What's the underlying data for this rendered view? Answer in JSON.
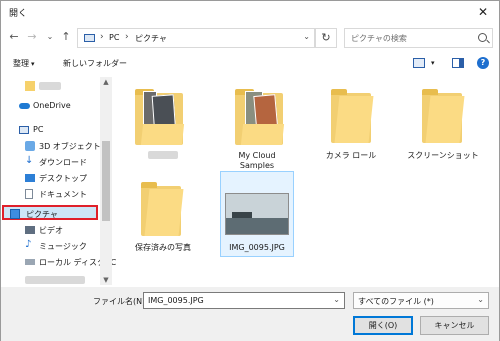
{
  "window": {
    "title": "開く",
    "close_glyph": "✕"
  },
  "nav": {
    "back_glyph": "←",
    "forward_glyph": "→",
    "recent_glyph": "⌄",
    "up_glyph": "↑",
    "breadcrumb": [
      "PC",
      "ピクチャ"
    ],
    "breadcrumb_sep": "›",
    "refresh_glyph": "↻",
    "search_placeholder": "ピクチャの検索"
  },
  "commands": {
    "organize": "整理",
    "new_folder": "新しいフォルダー",
    "caret": "▾",
    "help": "?"
  },
  "navpane": {
    "items": [
      {
        "label": "OneDrive",
        "icon": "onedrive-icon"
      },
      {
        "label": "PC",
        "icon": "pc-icon"
      },
      {
        "label": "3D オブジェクト",
        "icon": "3d-objects-icon"
      },
      {
        "label": "ダウンロード",
        "icon": "download-icon"
      },
      {
        "label": "デスクトップ",
        "icon": "desktop-icon"
      },
      {
        "label": "ドキュメント",
        "icon": "document-icon"
      },
      {
        "label": "ピクチャ",
        "icon": "pictures-icon",
        "selected": true
      },
      {
        "label": "ビデオ",
        "icon": "video-icon"
      },
      {
        "label": "ミュージック",
        "icon": "music-icon"
      },
      {
        "label": "ローカル ディスク (C",
        "icon": "disk-icon"
      }
    ]
  },
  "content": {
    "items": [
      {
        "label": "",
        "type": "folder-photos"
      },
      {
        "label": "My Cloud\nSamples",
        "type": "folder-photos"
      },
      {
        "label": "カメラ ロール",
        "type": "folder"
      },
      {
        "label": "スクリーンショット",
        "type": "folder"
      },
      {
        "label": "保存済みの写真",
        "type": "folder"
      },
      {
        "label": "IMG_0095.JPG",
        "type": "image",
        "selected": true
      }
    ]
  },
  "footer": {
    "filename_label": "ファイル名(N):",
    "filename_value": "IMG_0095.JPG",
    "filter_value": "すべてのファイル (*)",
    "open_label": "開く(O)",
    "cancel_label": "キャンセル",
    "dd_glyph": "⌄"
  },
  "colors": {
    "accent": "#0078d7",
    "selected_outline": "#e0202a",
    "folder": "#f8d775"
  }
}
